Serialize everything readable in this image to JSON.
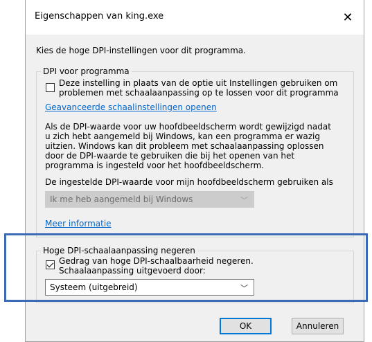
{
  "window": {
    "title": "Eigenschappen van king.exe",
    "close_symbol": "✕"
  },
  "intro": "Kies de hoge DPI-instellingen voor dit programma.",
  "dpi_program": {
    "legend": "DPI voor programma",
    "checkbox_line1": "Deze instelling in plaats van de optie uit Instellingen gebruiken om",
    "checkbox_line2": "problemen met schaalaanpassing op te lossen voor dit programma",
    "checkbox_checked": false,
    "advanced_link": "Geavanceerde schaalinstellingen openen",
    "description": [
      "Als de DPI-waarde voor uw hoofdbeeldscherm wordt gewijzigd nadat",
      "u zich hebt aangemeld bij Windows, kan een programma er wazig",
      "uitzien. Windows kan dit probleem met schaalaanpassing oplossen",
      "door de DPI-waarde te gebruiken die bij het openen van het",
      "programma is ingesteld voor het hoofdbeeldscherm."
    ],
    "use_label": "De ingestelde DPI-waarde voor mijn hoofdbeeldscherm gebruiken als",
    "select_value": "Ik me heb aangemeld bij Windows",
    "more_info_link": "Meer informatie"
  },
  "high_dpi": {
    "legend": "Hoge DPI-schaalaanpassing negeren",
    "checkbox_line1": "Gedrag van hoge DPI-schaalbaarheid negeren.",
    "checkbox_line2": "Schaalaanpassing uitgevoerd door:",
    "checkbox_checked": true,
    "select_value": "Systeem (uitgebreid)"
  },
  "buttons": {
    "ok": "OK",
    "cancel": "Annuleren"
  },
  "colors": {
    "highlight": "#3c6bb5",
    "link": "#0066cc",
    "dialog_bg": "#f0f0f0"
  }
}
